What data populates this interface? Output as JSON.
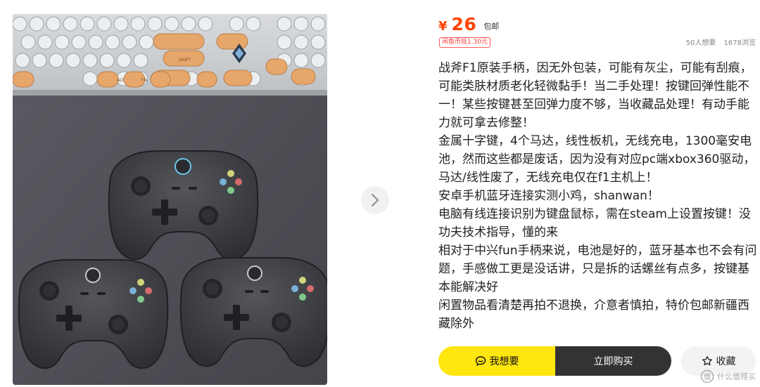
{
  "listing": {
    "price_symbol": "¥",
    "price": "26",
    "shipping": "包邮",
    "coin_discount": "闲鱼币抵1.30元",
    "want_count": "50人想要",
    "view_count": "1678浏览",
    "description": [
      "战斧F1原装手柄，因无外包装，可能有灰尘，可能有刮痕，可能类肤材质老化轻微黏手！当二手处理！按键回弹性能不一！某些按键甚至回弹力度不够，当收藏品处理！有动手能力就可拿去修整！",
      "金属十字键，4个马达，线性板机，无线充电，1300毫安电池，然而这些都是废话，因为没有对应pc端xbox360驱动，马达/线性废了，无线充电仅在f1主机上！",
      "安卓手机蓝牙连接实测小鸡，shanwan！",
      "电脑有线连接识别为键盘鼠标，需在steam上设置按键！没功夫技术指导，懂的来",
      "相对于中兴fun手柄来说，电池是好的，蓝牙基本也不会有问题，手感做工更是没话讲，只是拆的话螺丝有点多，按键基本能解决好",
      "闲置物品看清楚再拍不退换，介意者慎拍，特价包邮新疆西藏除外"
    ]
  },
  "actions": {
    "want_label": "我想要",
    "buy_label": "立即购买",
    "fav_label": "收藏"
  },
  "photo_keys": {
    "shift_label": "SHIFT",
    "alt_label": "ALT",
    "fn_label": "FN"
  },
  "watermark": "什么值得买",
  "colors": {
    "price": "#ff4400",
    "want_button": "#ffe60f",
    "buy_button": "#333333"
  }
}
